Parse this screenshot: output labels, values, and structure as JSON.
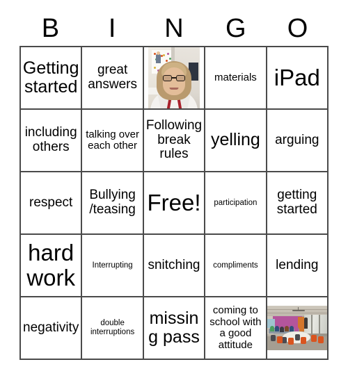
{
  "card": {
    "header_letters": [
      "B",
      "I",
      "N",
      "G",
      "O"
    ],
    "free_space_label": "Free!",
    "rows": [
      [
        {
          "type": "text",
          "text": "Getting started",
          "size": "lg"
        },
        {
          "type": "text",
          "text": "great answers",
          "size": "md"
        },
        {
          "type": "photo",
          "photo": "teacher-portrait-photo",
          "text": ""
        },
        {
          "type": "text",
          "text": "materials",
          "size": "sm"
        },
        {
          "type": "text",
          "text": "iPad",
          "size": "xl"
        }
      ],
      [
        {
          "type": "text",
          "text": "including others",
          "size": "md"
        },
        {
          "type": "text",
          "text": "talking over each other",
          "size": "sm"
        },
        {
          "type": "text",
          "text": "Following break rules",
          "size": "md"
        },
        {
          "type": "text",
          "text": "yelling",
          "size": "lg"
        },
        {
          "type": "text",
          "text": "arguing",
          "size": "md"
        }
      ],
      [
        {
          "type": "text",
          "text": "respect",
          "size": "md"
        },
        {
          "type": "text",
          "text": "Bullying /teasing",
          "size": "md"
        },
        {
          "type": "text",
          "text": "Free!",
          "size": "xl"
        },
        {
          "type": "text",
          "text": "participation",
          "size": "xs"
        },
        {
          "type": "text",
          "text": "getting started",
          "size": "md"
        }
      ],
      [
        {
          "type": "text",
          "text": "hard work",
          "size": "xl"
        },
        {
          "type": "text",
          "text": "Interrupting",
          "size": "xs"
        },
        {
          "type": "text",
          "text": "snitching",
          "size": "md"
        },
        {
          "type": "text",
          "text": "compliments",
          "size": "xs"
        },
        {
          "type": "text",
          "text": "lending",
          "size": "md"
        }
      ],
      [
        {
          "type": "text",
          "text": "negativity",
          "size": "md"
        },
        {
          "type": "text",
          "text": "double interruptions",
          "size": "xs"
        },
        {
          "type": "text",
          "text": "missing pass",
          "size": "lg"
        },
        {
          "type": "text",
          "text": "coming to school with a good attitude",
          "size": "sm"
        },
        {
          "type": "photo",
          "photo": "classroom-photo",
          "text": ""
        }
      ]
    ]
  },
  "colors": {
    "background": "#ffffff",
    "border": "#4a4a4a",
    "text": "#000000",
    "classroom_accent_wall": "#b4559c",
    "chair_orange": "#d9541f",
    "lanyard_red": "#a8212b"
  }
}
